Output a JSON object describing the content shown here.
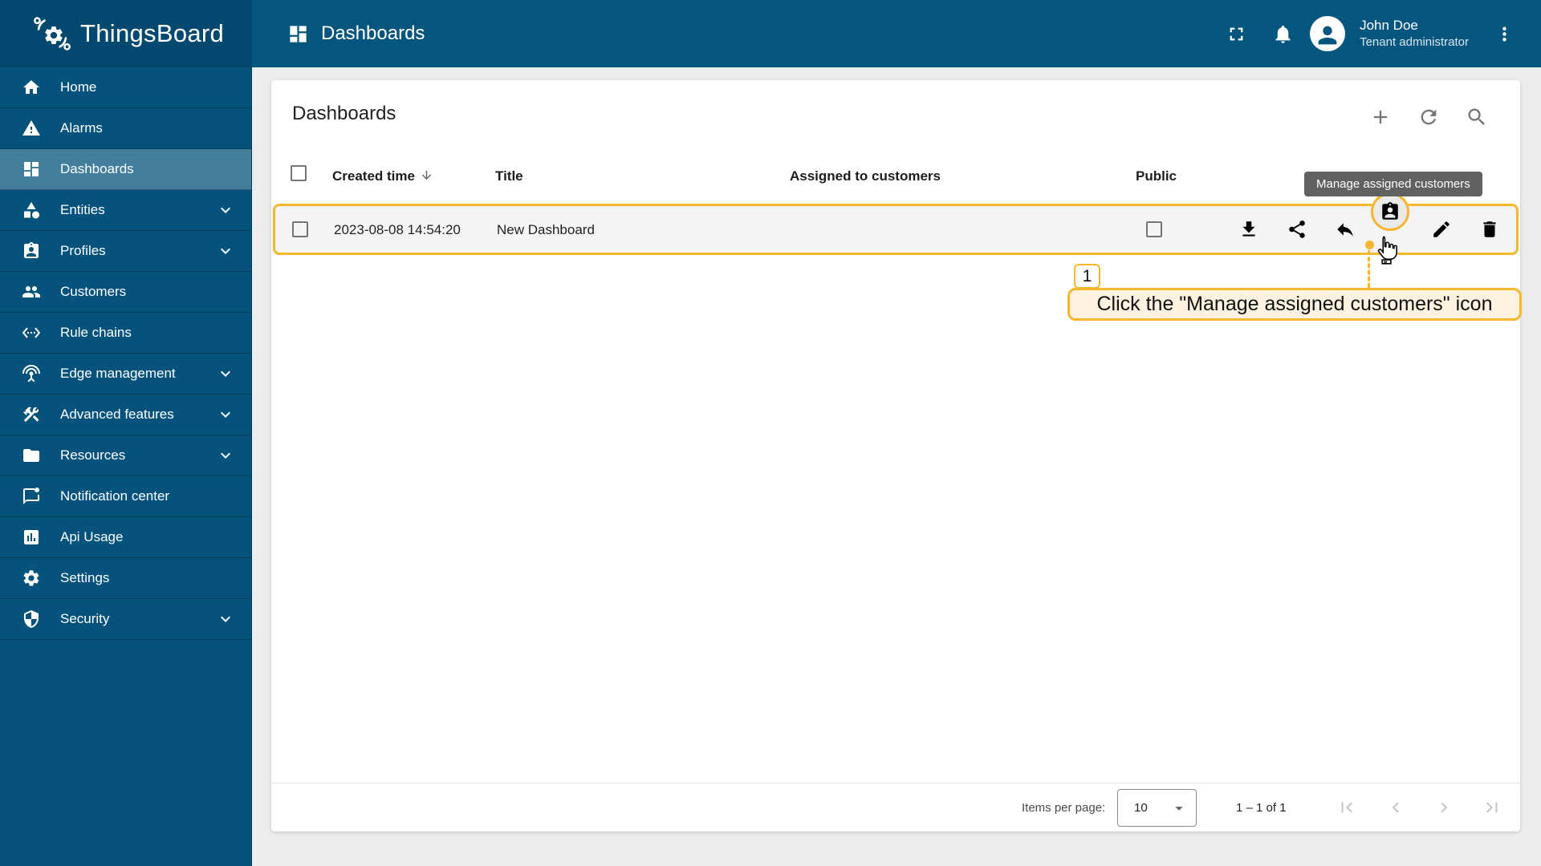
{
  "colors": {
    "primary_blue": "#05567F",
    "logo_strip_blue": "#03496F",
    "active_item_overlay": "rgba(255,255,255,0.25)",
    "content_background": "#ECECEC",
    "highlight_yellow": "#F5B72E",
    "annotation_background": "#FCF2DF",
    "tooltip_background": "#616161",
    "row_background": "#F4F4F4"
  },
  "topbar": {
    "logo_text": "ThingsBoard",
    "title": "Dashboards",
    "icons": [
      "fullscreen",
      "notifications-bell",
      "avatar",
      "more-vert"
    ],
    "user": {
      "name": "John Doe",
      "role": "Tenant administrator"
    }
  },
  "sidebar": {
    "items": [
      {
        "label": "Home",
        "icon": "home",
        "expandable": false,
        "active": false
      },
      {
        "label": "Alarms",
        "icon": "alarms",
        "expandable": false,
        "active": false
      },
      {
        "label": "Dashboards",
        "icon": "dashboards",
        "expandable": false,
        "active": true
      },
      {
        "label": "Entities",
        "icon": "entities",
        "expandable": true,
        "active": false
      },
      {
        "label": "Profiles",
        "icon": "profiles",
        "expandable": true,
        "active": false
      },
      {
        "label": "Customers",
        "icon": "customers",
        "expandable": false,
        "active": false
      },
      {
        "label": "Rule chains",
        "icon": "rule-chains",
        "expandable": false,
        "active": false
      },
      {
        "label": "Edge management",
        "icon": "edge-management",
        "expandable": true,
        "active": false
      },
      {
        "label": "Advanced features",
        "icon": "advanced-features",
        "expandable": true,
        "active": false
      },
      {
        "label": "Resources",
        "icon": "resources",
        "expandable": true,
        "active": false
      },
      {
        "label": "Notification center",
        "icon": "notification-center",
        "expandable": false,
        "active": false
      },
      {
        "label": "Api Usage",
        "icon": "api-usage",
        "expandable": false,
        "active": false
      },
      {
        "label": "Settings",
        "icon": "settings",
        "expandable": false,
        "active": false
      },
      {
        "label": "Security",
        "icon": "security",
        "expandable": true,
        "active": false
      }
    ]
  },
  "main": {
    "card_title": "Dashboards",
    "toolbar_icons": [
      "add",
      "refresh",
      "search"
    ],
    "table": {
      "columns": {
        "created_time": "Created time",
        "title": "Title",
        "assigned": "Assigned to customers",
        "public": "Public"
      },
      "sort_column": "Created time",
      "sort_direction": "desc",
      "rows": [
        {
          "created_time": "2023-08-08 14:54:20",
          "title": "New Dashboard",
          "public": false
        }
      ],
      "row_actions": [
        "download",
        "share",
        "make-private",
        "manage-assigned-customers",
        "edit",
        "delete"
      ]
    },
    "tooltip": {
      "text": "Manage assigned customers"
    },
    "annotation": {
      "step": "1",
      "text": "Click the \"Manage assigned customers\" icon"
    },
    "paginator": {
      "label": "Items per page:",
      "page_size": "10",
      "range": "1 – 1 of 1"
    }
  }
}
